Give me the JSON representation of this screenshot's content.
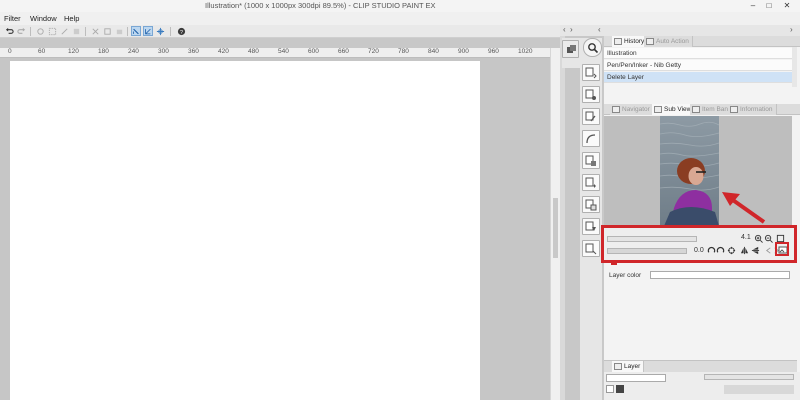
{
  "window": {
    "title": "Illustration* (1000 x 1000px 300dpi 89.5%) - CLIP STUDIO PAINT EX",
    "minimize": "–",
    "maximize": "□",
    "close": "✕"
  },
  "menu": [
    "Filter",
    "Window",
    "Help"
  ],
  "ruler": [
    "0",
    "60",
    "120",
    "180",
    "240",
    "300",
    "360",
    "420",
    "480",
    "540",
    "600",
    "660",
    "720",
    "780",
    "840",
    "900",
    "960",
    "1020"
  ],
  "panel_top": {
    "left_arrow": "‹",
    "right_arrow": "›"
  },
  "history": {
    "tabs": [
      "History",
      "Auto Action"
    ],
    "items": [
      "Illustration",
      "Pen/Pen/Inker - Nib Getty",
      "Delete Layer"
    ],
    "selected_index": 2
  },
  "subview": {
    "tabs": [
      "Navigator",
      "Sub View",
      "Item Bank",
      "Information"
    ],
    "zoom_value": "4.1",
    "angle_value": "0.0",
    "highlight_color": "#d0262a"
  },
  "layer_property": {
    "layer_color_label": "Layer color"
  },
  "layer_panel": {
    "tab_label": "Layer"
  }
}
